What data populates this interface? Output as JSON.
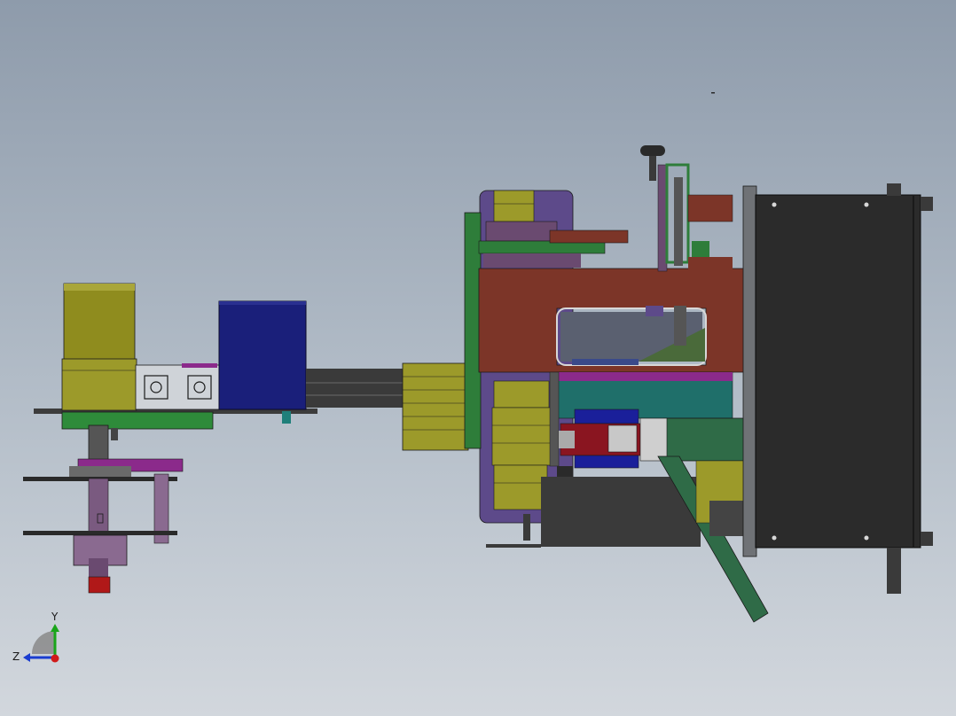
{
  "triad": {
    "y_label": "Y",
    "z_label": "Z"
  },
  "colors": {
    "background_top": "#8e9bab",
    "background_bottom": "#d2d7dd",
    "frame_dark": "#3a3a3a",
    "housing_black": "#2b2b2b",
    "rust_red": "#7c3528",
    "olive": "#9c9a2a",
    "navy": "#1a1f7a",
    "green": "#2e7d3a",
    "violet": "#5d4a8a",
    "teal": "#1f6f6a",
    "magenta": "#8b2a8b",
    "axis_y": "#1aa51a",
    "axis_z": "#1a3cd0",
    "axis_x": "#d01a1a"
  }
}
